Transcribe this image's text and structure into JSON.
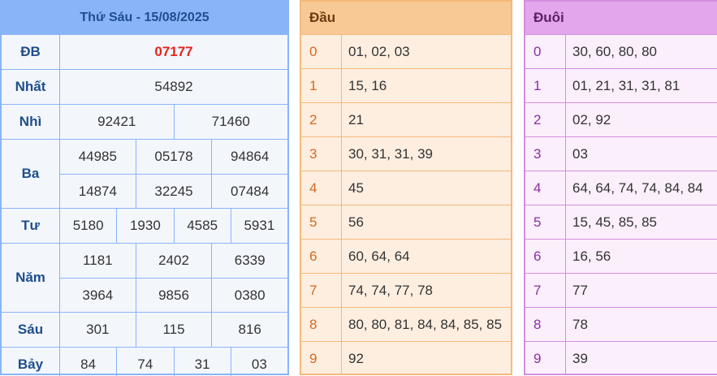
{
  "results": {
    "title": "Thứ Sáu - 15/08/2025",
    "prizes": [
      {
        "label": "ĐB",
        "rows": [
          [
            "07177"
          ]
        ]
      },
      {
        "label": "Nhất",
        "rows": [
          [
            "54892"
          ]
        ]
      },
      {
        "label": "Nhì",
        "rows": [
          [
            "92421",
            "71460"
          ]
        ]
      },
      {
        "label": "Ba",
        "rows": [
          [
            "44985",
            "05178",
            "94864"
          ],
          [
            "14874",
            "32245",
            "07484"
          ]
        ]
      },
      {
        "label": "Tư",
        "rows": [
          [
            "5180",
            "1930",
            "4585",
            "5931"
          ]
        ]
      },
      {
        "label": "Năm",
        "rows": [
          [
            "1181",
            "2402",
            "6339"
          ],
          [
            "3964",
            "9856",
            "0380"
          ]
        ]
      },
      {
        "label": "Sáu",
        "rows": [
          [
            "301",
            "115",
            "816"
          ]
        ]
      },
      {
        "label": "Bảy",
        "rows": [
          [
            "84",
            "74",
            "31",
            "03"
          ]
        ]
      }
    ]
  },
  "dau": {
    "header": "Đầu",
    "rows": [
      {
        "key": "0",
        "values": "01, 02, 03"
      },
      {
        "key": "1",
        "values": "15, 16"
      },
      {
        "key": "2",
        "values": "21"
      },
      {
        "key": "3",
        "values": "30, 31, 31, 39"
      },
      {
        "key": "4",
        "values": "45"
      },
      {
        "key": "5",
        "values": "56"
      },
      {
        "key": "6",
        "values": "60, 64, 64"
      },
      {
        "key": "7",
        "values": "74, 74, 77, 78"
      },
      {
        "key": "8",
        "values": "80, 80, 81, 84, 84, 85, 85"
      },
      {
        "key": "9",
        "values": "92"
      }
    ]
  },
  "duoi": {
    "header": "Đuôi",
    "rows": [
      {
        "key": "0",
        "values": "30, 60, 80, 80"
      },
      {
        "key": "1",
        "values": "01, 21, 31, 31, 81"
      },
      {
        "key": "2",
        "values": "02, 92"
      },
      {
        "key": "3",
        "values": "03"
      },
      {
        "key": "4",
        "values": "64, 64, 74, 74, 84, 84"
      },
      {
        "key": "5",
        "values": "15, 45, 85, 85"
      },
      {
        "key": "6",
        "values": "16, 56"
      },
      {
        "key": "7",
        "values": "77"
      },
      {
        "key": "8",
        "values": "78"
      },
      {
        "key": "9",
        "values": "39"
      }
    ]
  }
}
